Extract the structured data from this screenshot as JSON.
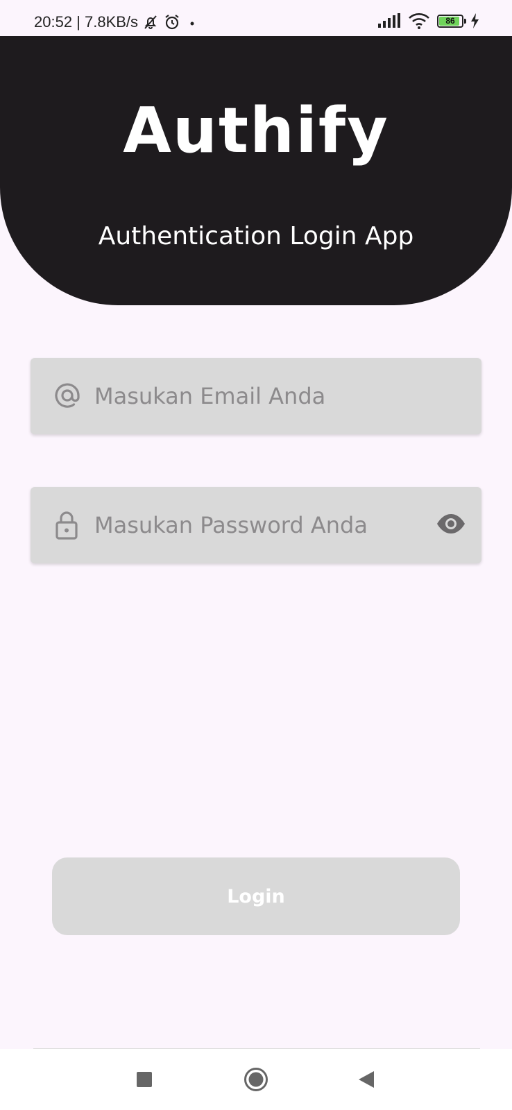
{
  "status_bar": {
    "time_speed": "20:52 | 7.8KB/s",
    "battery_level": "86",
    "icons": [
      "mute-bell-icon",
      "alarm-icon",
      "dot-icon",
      "signal-icon",
      "wifi-icon",
      "battery-icon",
      "charging-icon"
    ]
  },
  "header": {
    "title": "Authify",
    "subtitle": "Authentication Login App",
    "background_color": "#1e1b1e"
  },
  "form": {
    "email": {
      "placeholder": "Masukan Email Anda",
      "value": "",
      "icon": "at-sign-icon"
    },
    "password": {
      "placeholder": "Masukan Password Anda",
      "value": "",
      "icon": "lock-icon",
      "toggle_icon": "eye-icon"
    },
    "login_label": "Login"
  },
  "nav": {
    "buttons": [
      "recents-square-icon",
      "home-circle-icon",
      "back-triangle-icon"
    ]
  }
}
